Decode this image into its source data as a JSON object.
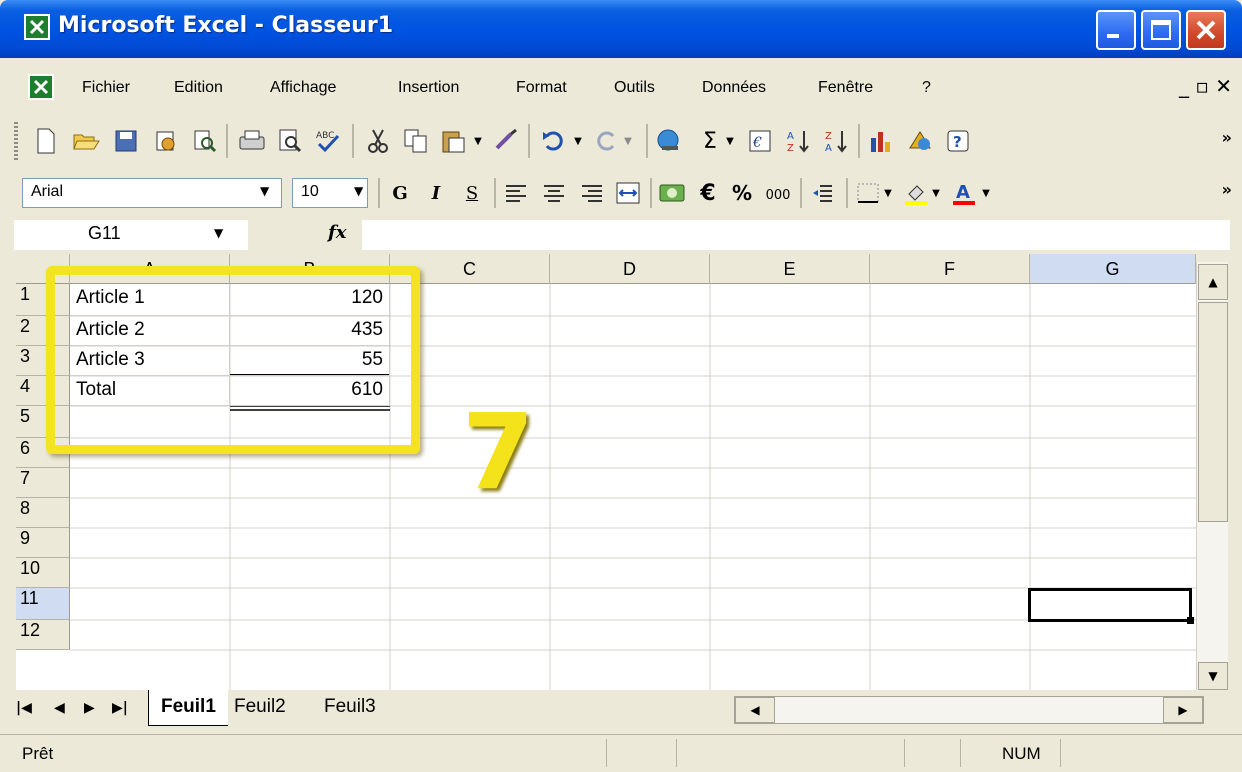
{
  "window": {
    "title": "Microsoft Excel - Classeur1"
  },
  "menu": {
    "items": [
      "Fichier",
      "Edition",
      "Affichage",
      "Insertion",
      "Format",
      "Outils",
      "Données",
      "Fenêtre",
      "?"
    ]
  },
  "format_toolbar": {
    "font": "Arial",
    "size": "10",
    "bold_label": "G",
    "italic_label": "I",
    "underline_label": "S"
  },
  "formula_bar": {
    "name_box": "G11",
    "fx": "fx",
    "content": ""
  },
  "sheet": {
    "columns": [
      "A",
      "B",
      "C",
      "D",
      "E",
      "F",
      "G"
    ],
    "rows": [
      "1",
      "2",
      "3",
      "4",
      "5",
      "6",
      "7",
      "8",
      "9",
      "10",
      "11",
      "12"
    ],
    "active_column": "G",
    "active_row": "11",
    "cells": [
      {
        "ref": "A1",
        "value": "Article 1"
      },
      {
        "ref": "B1",
        "value": "120"
      },
      {
        "ref": "A2",
        "value": "Article 2"
      },
      {
        "ref": "B2",
        "value": "435"
      },
      {
        "ref": "A3",
        "value": "Article 3"
      },
      {
        "ref": "B3",
        "value": "55"
      },
      {
        "ref": "A4",
        "value": "Total"
      },
      {
        "ref": "B4",
        "value": "610"
      }
    ]
  },
  "annotation": {
    "step_number": "7",
    "highlight_color": "#f3e320"
  },
  "tabs": [
    "Feuil1",
    "Feuil2",
    "Feuil3"
  ],
  "active_tab": "Feuil1",
  "status": {
    "text": "Prêt",
    "num": "NUM"
  },
  "icons": [
    "excel-logo-icon",
    "new-icon",
    "open-icon",
    "save-icon",
    "permission-icon",
    "search-icon",
    "print-icon",
    "preview-icon",
    "spelling-icon",
    "cut-icon",
    "copy-icon",
    "paste-icon",
    "format-painter-icon",
    "undo-icon",
    "redo-icon",
    "hyperlink-icon",
    "autosum-icon",
    "function-icon",
    "sort-asc-icon",
    "sort-desc-icon",
    "chart-icon",
    "drawing-icon",
    "help-icon"
  ]
}
